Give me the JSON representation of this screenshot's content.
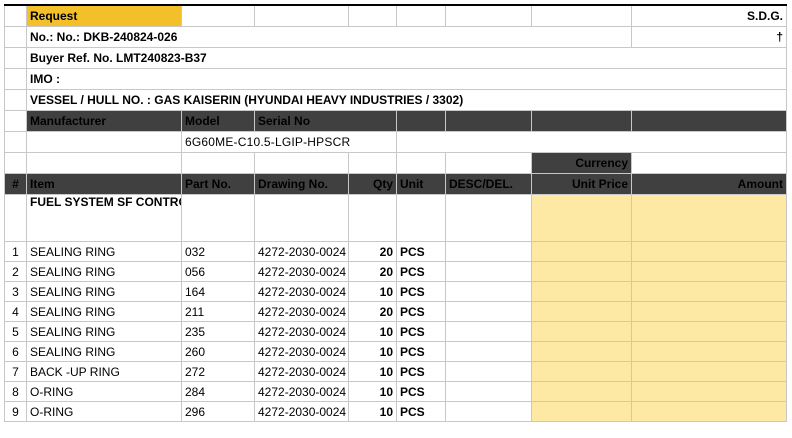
{
  "header": {
    "request_label": "Request",
    "sdg": "S.D.G.",
    "dagger": "†",
    "no_line": "No.:  No.:  DKB-240824-026",
    "buyer_ref": "Buyer Ref. No. LMT240823-B37",
    "imo": "IMO :",
    "vessel": "VESSEL / HULL NO. : GAS KAISERIN (HYUNDAI HEAVY INDUSTRIES / 3302)"
  },
  "equipment": {
    "manufacturer_label": "Manufacturer",
    "model_label": "Model",
    "serial_label": "Serial No",
    "model_value": "6G60ME-C10.5-LGIP-HPSCR"
  },
  "columns": {
    "currency": "Currency",
    "num": "#",
    "item": "Item",
    "part_no": "Part No.",
    "drawing_no": "Drawing No.",
    "qty": "Qty",
    "unit": "Unit",
    "desc": "DESC/DEL.",
    "unit_price": "Unit Price",
    "amount": "Amount"
  },
  "group_title": "FUEL SYSTEM SF CONTROL V/V SPARE PART",
  "items": [
    {
      "num": "1",
      "item": "SEALING RING",
      "part_no": "032",
      "drawing_no": "4272-2030-0024",
      "qty": "20",
      "unit": "PCS"
    },
    {
      "num": "2",
      "item": "SEALING RING",
      "part_no": "056",
      "drawing_no": "4272-2030-0024",
      "qty": "20",
      "unit": "PCS"
    },
    {
      "num": "3",
      "item": "SEALING RING",
      "part_no": "164",
      "drawing_no": "4272-2030-0024",
      "qty": "10",
      "unit": "PCS"
    },
    {
      "num": "4",
      "item": "SEALING RING",
      "part_no": "211",
      "drawing_no": "4272-2030-0024",
      "qty": "20",
      "unit": "PCS"
    },
    {
      "num": "5",
      "item": "SEALING RING",
      "part_no": "235",
      "drawing_no": "4272-2030-0024",
      "qty": "10",
      "unit": "PCS"
    },
    {
      "num": "6",
      "item": "SEALING RING",
      "part_no": "260",
      "drawing_no": "4272-2030-0024",
      "qty": "10",
      "unit": "PCS"
    },
    {
      "num": "7",
      "item": "BACK -UP RING",
      "part_no": "272",
      "drawing_no": "4272-2030-0024",
      "qty": "10",
      "unit": "PCS"
    },
    {
      "num": "8",
      "item": "O-RING",
      "part_no": "284",
      "drawing_no": "4272-2030-0024",
      "qty": "10",
      "unit": "PCS"
    },
    {
      "num": "9",
      "item": "O-RING",
      "part_no": "296",
      "drawing_no": "4272-2030-0024",
      "qty": "10",
      "unit": "PCS"
    }
  ],
  "colors": {
    "header_dark": "#404040",
    "accent_gold": "#8a6a1f",
    "request_fill": "#f4c02a",
    "price_fill": "#fde8a4"
  }
}
